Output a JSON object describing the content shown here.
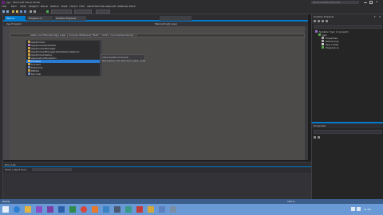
{
  "window": {
    "title": "Jiya - Microsoft Visual Studio"
  },
  "menu": [
    "FILE",
    "EDIT",
    "VIEW",
    "PROJECT",
    "BUILD",
    "DEBUG",
    "TEAM",
    "TOOLS",
    "TEST",
    "ARCHITECTURE",
    "ANALYZE",
    "WINDOW",
    "HELP"
  ],
  "quick_launch": "Quick Launch (Ctrl+Q)",
  "tabs": [
    {
      "label": "Test.cs",
      "active": false
    },
    {
      "label": "Program.cs",
      "active": true
    },
    {
      "label": "Solution Explorer",
      "active": false
    }
  ],
  "editor": {
    "nav_left": "Jiya.Program",
    "nav_right": "Main(string[] args)",
    "line1": "static void Main(string[] args)  {  Console.WriteLine(\"Hello\", \"Add\");  Console.ReadLine();  }"
  },
  "intellisense": {
    "items": [
      "AppDomain",
      "AppDomainInitializer",
      "AppDomainManager",
      "AppDomainManagerInitializationOptions",
      "AppDomainSetup",
      "ApplicationException",
      "Console",
      "Convert",
      "DateTime",
      "DBNull",
      "Decimal"
    ],
    "selected": 6,
    "tooltip1": "class System.Console",
    "tooltip2": "Represents the standard input, output, and error streams."
  },
  "solution_explorer": {
    "title": "Solution Explorer",
    "items": [
      "Solution 'Jiya' (1 project)",
      "Jiya",
      "Properties",
      "References",
      "App.config",
      "Program.cs"
    ]
  },
  "properties": {
    "title": "Properties"
  },
  "output": {
    "title": "Error List",
    "label": "Show output from:"
  },
  "status": {
    "zoom": "100 %",
    "text": "Ready"
  },
  "taskbar": {
    "icons": [
      "start-icon",
      "ie-icon",
      "folder-icon",
      "vs-icon",
      "onenote-icon",
      "word-icon",
      "excel-icon",
      "chrome-icon",
      "media-icon",
      "mail-icon",
      "calc-icon",
      "app-icon",
      "app2-icon",
      "app3-icon",
      "app4-icon",
      "app5-icon"
    ],
    "time": "11:04"
  },
  "colors": {
    "accent": "#007acc",
    "taskbar": "#6a9ad6",
    "editor": "#4d4b49",
    "chrome": "#2d2d30"
  }
}
